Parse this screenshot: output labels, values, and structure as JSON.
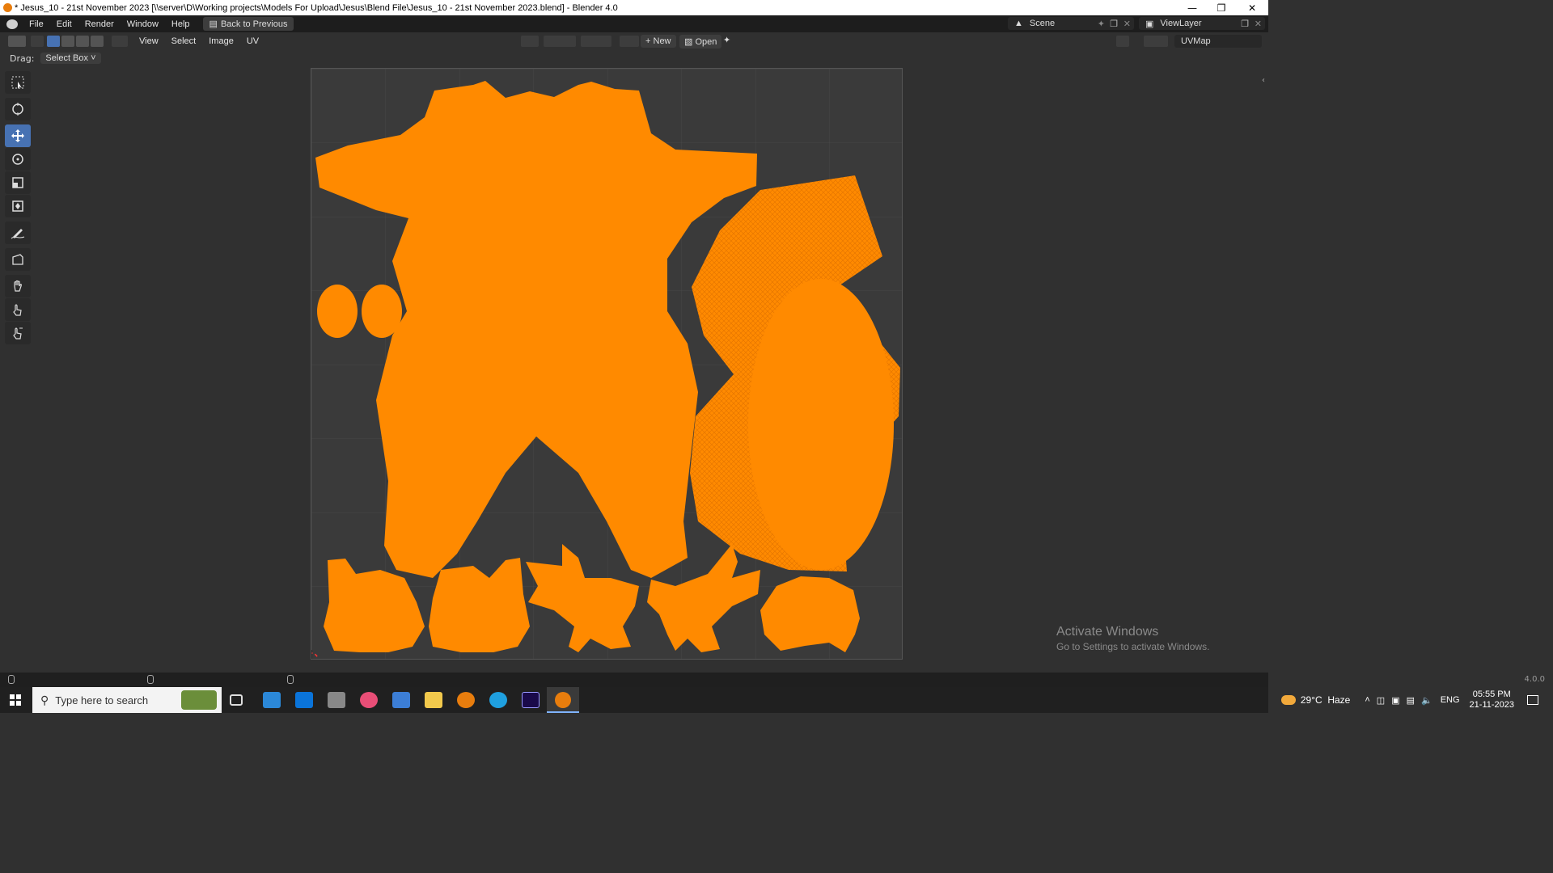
{
  "window": {
    "title": "* Jesus_10 - 21st November 2023 [\\\\server\\D\\Working projects\\Models For Upload\\Jesus\\Blend File\\Jesus_10 - 21st November 2023.blend] - Blender 4.0"
  },
  "topbar": {
    "menus": [
      "File",
      "Edit",
      "Render",
      "Window",
      "Help"
    ],
    "back_button": "Back to Previous",
    "scene": "Scene",
    "view_layer": "ViewLayer"
  },
  "header": {
    "menus": [
      "View",
      "Select",
      "Image",
      "UV"
    ],
    "new_button": "New",
    "open_button": "Open",
    "uv_map": "UVMap"
  },
  "tool_settings": {
    "drag_label": "Drag:",
    "drag_value": "Select Box"
  },
  "tools": [
    "select-box-icon",
    "cursor-icon",
    "move-icon",
    "rotate-icon",
    "scale-icon",
    "transform-icon",
    "annotate-icon",
    "rip-icon",
    "grab-icon",
    "relax-icon",
    "pinch-icon"
  ],
  "watermark": {
    "line1": "Activate Windows",
    "line2": "Go to Settings to activate Windows."
  },
  "version": "4.0.0",
  "taskbar": {
    "search_placeholder": "Type here to search",
    "weather": "29°C  Haze",
    "lang": "ENG",
    "time": "05:55 PM",
    "date": "21-11-2023"
  },
  "colors": {
    "uv_fill": "#ff8a00",
    "accent": "#4772b3"
  }
}
